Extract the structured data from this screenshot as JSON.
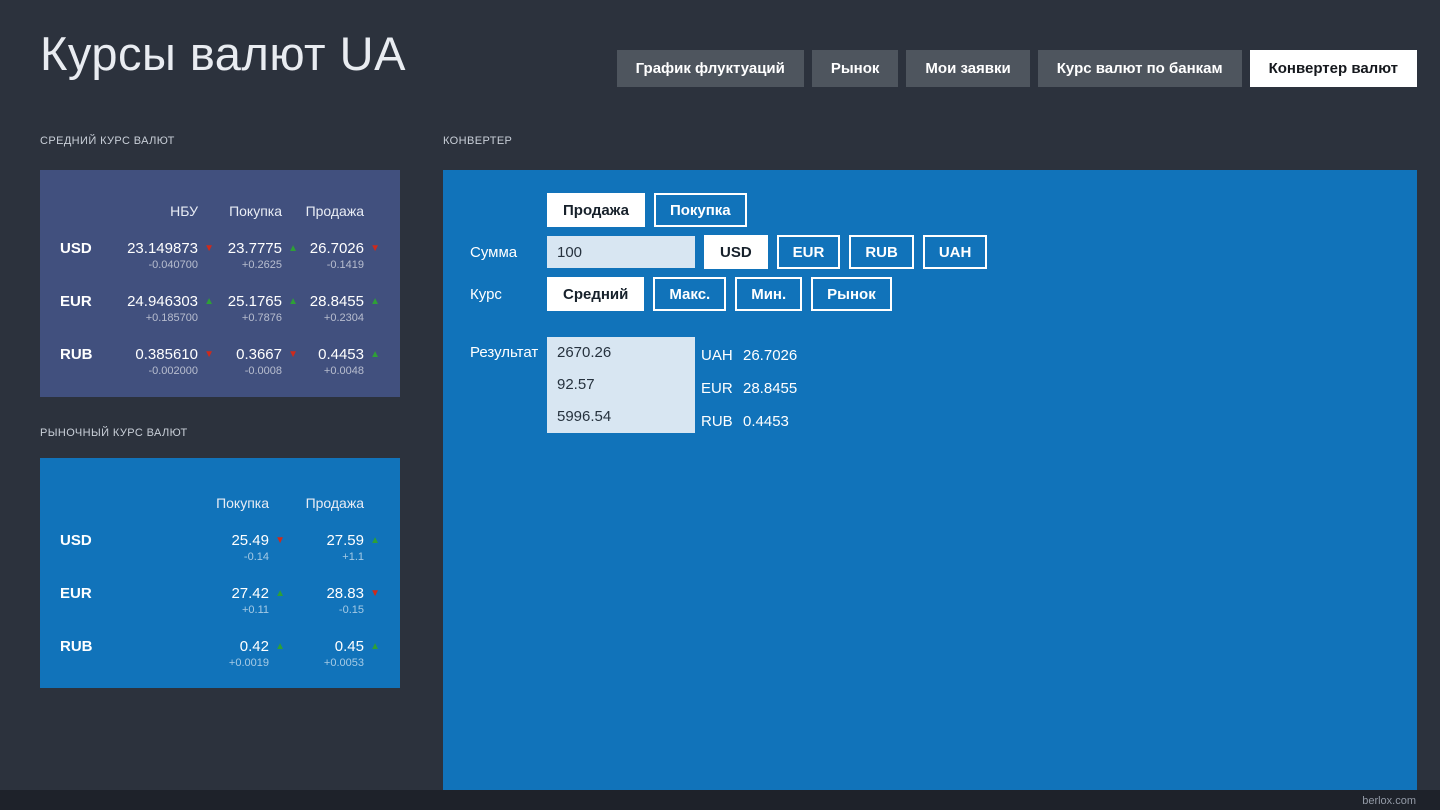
{
  "app": {
    "title": "Курсы валют UA",
    "footer": "berlox.com"
  },
  "nav": {
    "items": [
      {
        "label": "График флуктуаций",
        "active": false
      },
      {
        "label": "Рынок",
        "active": false
      },
      {
        "label": "Мои заявки",
        "active": false
      },
      {
        "label": "Курс валют по банкам",
        "active": false
      },
      {
        "label": "Конвертер валют",
        "active": true
      }
    ]
  },
  "avg_rates": {
    "section_title": "СРЕДНИЙ КУРС ВАЛЮТ",
    "headers": [
      "НБУ",
      "Покупка",
      "Продажа"
    ],
    "rows": [
      {
        "code": "USD",
        "cells": [
          {
            "value": "23.149873",
            "dir": "down",
            "change": "-0.040700"
          },
          {
            "value": "23.7775",
            "dir": "up",
            "change": "+0.2625"
          },
          {
            "value": "26.7026",
            "dir": "down",
            "change": "-0.1419"
          }
        ]
      },
      {
        "code": "EUR",
        "cells": [
          {
            "value": "24.946303",
            "dir": "up",
            "change": "+0.185700"
          },
          {
            "value": "25.1765",
            "dir": "up",
            "change": "+0.7876"
          },
          {
            "value": "28.8455",
            "dir": "up",
            "change": "+0.2304"
          }
        ]
      },
      {
        "code": "RUB",
        "cells": [
          {
            "value": "0.385610",
            "dir": "down",
            "change": "-0.002000"
          },
          {
            "value": "0.3667",
            "dir": "down",
            "change": "-0.0008"
          },
          {
            "value": "0.4453",
            "dir": "up",
            "change": "+0.0048"
          }
        ]
      }
    ]
  },
  "market_rates": {
    "section_title": "РЫНОЧНЫЙ КУРС ВАЛЮТ",
    "headers": [
      "Покупка",
      "Продажа"
    ],
    "rows": [
      {
        "code": "USD",
        "cells": [
          {
            "value": "25.49",
            "dir": "down",
            "change": "-0.14"
          },
          {
            "value": "27.59",
            "dir": "up",
            "change": "+1.1"
          }
        ]
      },
      {
        "code": "EUR",
        "cells": [
          {
            "value": "27.42",
            "dir": "up",
            "change": "+0.11"
          },
          {
            "value": "28.83",
            "dir": "down",
            "change": "-0.15"
          }
        ]
      },
      {
        "code": "RUB",
        "cells": [
          {
            "value": "0.42",
            "dir": "up",
            "change": "+0.0019"
          },
          {
            "value": "0.45",
            "dir": "up",
            "change": "+0.0053"
          }
        ]
      }
    ]
  },
  "converter": {
    "section_title": "КОНВЕРТЕР",
    "modes": [
      {
        "label": "Продажа",
        "active": true
      },
      {
        "label": "Покупка",
        "active": false
      }
    ],
    "amount_label": "Сумма",
    "amount_value": "100",
    "currencies": [
      {
        "label": "USD",
        "active": true
      },
      {
        "label": "EUR",
        "active": false
      },
      {
        "label": "RUB",
        "active": false
      },
      {
        "label": "UAH",
        "active": false
      }
    ],
    "rate_label": "Курс",
    "rate_options": [
      {
        "label": "Средний",
        "active": true
      },
      {
        "label": "Макс.",
        "active": false
      },
      {
        "label": "Мин.",
        "active": false
      },
      {
        "label": "Рынок",
        "active": false
      }
    ],
    "result_label": "Результат",
    "results": [
      {
        "amount": "2670.26",
        "currency": "UAH",
        "rate": "26.7026"
      },
      {
        "amount": "92.57",
        "currency": "EUR",
        "rate": "28.8455"
      },
      {
        "amount": "5996.54",
        "currency": "RUB",
        "rate": "0.4453"
      }
    ]
  },
  "colors": {
    "background": "#2c323d",
    "panel_indigo": "#41507e",
    "panel_blue": "#1173ba",
    "button_gray": "#4e555e",
    "accent_up": "#2ea036",
    "accent_down": "#cf2a1b"
  }
}
